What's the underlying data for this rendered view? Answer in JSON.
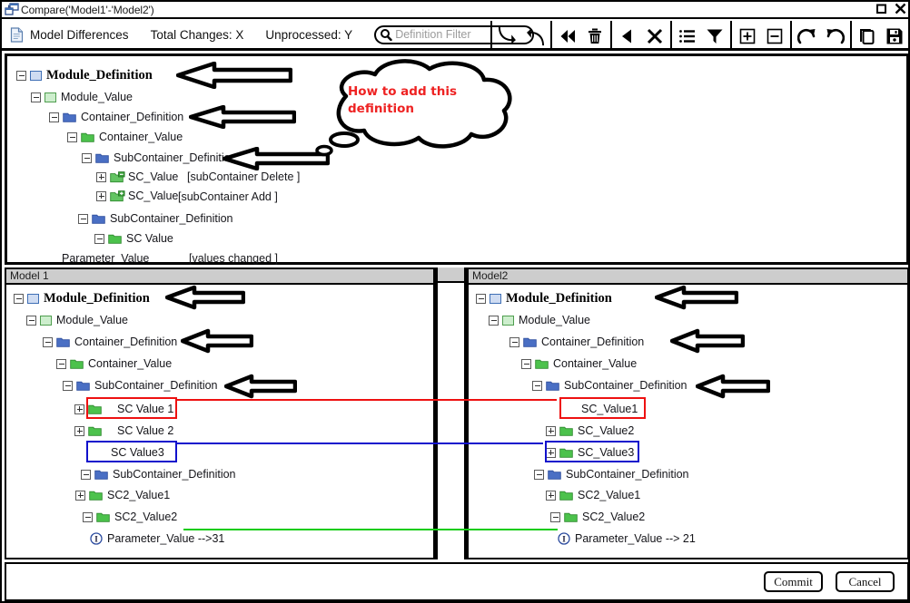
{
  "window": {
    "title": "Compare('Model1'-'Model2')",
    "icon": "compare-window-icon",
    "maximize_label": "maximize-icon",
    "close_label": "close-icon"
  },
  "toolbar": {
    "doc_icon": "document-icon",
    "model_differences_label": "Model Differences",
    "total_changes_label": "Total Changes: X",
    "unprocessed_label": "Unprocessed: Y",
    "search": {
      "icon": "search-icon",
      "placeholder": "Definition Filter",
      "value": ""
    },
    "buttons": [
      {
        "name": "accept-down-icon",
        "group": 1
      },
      {
        "name": "accept-up-icon",
        "group": 1
      },
      {
        "name": "rewind-icon",
        "group": 2
      },
      {
        "name": "delete-trash-icon",
        "group": 2
      },
      {
        "name": "previous-icon",
        "group": 3
      },
      {
        "name": "close-x-icon",
        "group": 3
      },
      {
        "name": "list-icon",
        "group": 4
      },
      {
        "name": "filter-icon",
        "group": 4
      },
      {
        "name": "expand-all-icon",
        "group": 5
      },
      {
        "name": "collapse-all-icon",
        "group": 5
      },
      {
        "name": "redo-icon",
        "group": 6
      },
      {
        "name": "undo-icon",
        "group": 6
      },
      {
        "name": "copy-icon",
        "group": 7
      },
      {
        "name": "save-icon",
        "group": 7
      }
    ]
  },
  "overview_tree": {
    "nodes": [
      {
        "label": "Module_Definition",
        "icon": "square-blue",
        "expander": "minus",
        "bold": true
      },
      {
        "label": "Module_Value",
        "icon": "square-green",
        "expander": "minus",
        "bold": false
      },
      {
        "label": "Container_Definition",
        "icon": "folder-blue",
        "expander": "minus",
        "bold": false
      },
      {
        "label": "Container_Value",
        "icon": "folder-green",
        "expander": "minus",
        "bold": false
      },
      {
        "label": "SubContainer_Definition",
        "icon": "folder-blue",
        "expander": "minus",
        "bold": false
      },
      {
        "label": "SC_Value",
        "icon": "folder-green-delete",
        "expander": "plus",
        "bold": false
      },
      {
        "label": "SC_Value",
        "icon": "folder-green-add",
        "expander": "plus",
        "bold": false
      },
      {
        "label": "SubContainer_Definition",
        "icon": "folder-blue",
        "expander": "minus",
        "bold": false
      },
      {
        "label": "SC Value",
        "icon": "folder-green",
        "expander": "minus",
        "bold": false
      },
      {
        "label": "Parameter_Value",
        "icon": "none",
        "expander": "none",
        "bold": false
      }
    ],
    "notes": [
      {
        "text": "[subContainer Delete ]"
      },
      {
        "text": "[subContainer Add ]"
      },
      {
        "text": "[values changed ]"
      }
    ],
    "callout": {
      "text": "How to add this\ndefinition",
      "color": "#ee2222"
    }
  },
  "panes": {
    "left": {
      "header": "Model 1",
      "nodes": [
        {
          "label": "Module_Definition",
          "icon": "square-blue",
          "expander": "minus",
          "bold": true
        },
        {
          "label": "Module_Value",
          "icon": "square-green",
          "expander": "minus",
          "bold": false
        },
        {
          "label": "Container_Definition",
          "icon": "folder-blue",
          "expander": "minus",
          "bold": false
        },
        {
          "label": "Container_Value",
          "icon": "folder-green",
          "expander": "minus",
          "bold": false
        },
        {
          "label": "SubContainer_Definition",
          "icon": "folder-blue",
          "expander": "minus",
          "bold": false
        },
        {
          "label": "SC Value 1",
          "icon": "folder-green",
          "expander": "plus",
          "bold": false
        },
        {
          "label": "SC Value 2",
          "icon": "folder-green",
          "expander": "plus",
          "bold": false
        },
        {
          "label": "SC Value3",
          "icon": "none",
          "expander": "none",
          "bold": false
        },
        {
          "label": "SubContainer_Definition",
          "icon": "folder-blue",
          "expander": "minus",
          "bold": false
        },
        {
          "label": "SC2_Value1",
          "icon": "folder-green",
          "expander": "plus",
          "bold": false
        },
        {
          "label": "SC2_Value2",
          "icon": "folder-green",
          "expander": "minus",
          "bold": false
        },
        {
          "label": "Parameter_Value -->31",
          "icon": "info-circle",
          "expander": "none",
          "bold": false
        }
      ]
    },
    "right": {
      "header": "Model2",
      "nodes": [
        {
          "label": "Module_Definition",
          "icon": "square-blue",
          "expander": "minus",
          "bold": true
        },
        {
          "label": "Module_Value",
          "icon": "square-green",
          "expander": "minus",
          "bold": false
        },
        {
          "label": "Container_Definition",
          "icon": "folder-blue",
          "expander": "minus",
          "bold": false
        },
        {
          "label": "Container_Value",
          "icon": "folder-green",
          "expander": "minus",
          "bold": false
        },
        {
          "label": "SubContainer_Definition",
          "icon": "folder-blue",
          "expander": "minus",
          "bold": false
        },
        {
          "label": "SC_Value1",
          "icon": "none",
          "expander": "none",
          "bold": false
        },
        {
          "label": "SC_Value2",
          "icon": "folder-green",
          "expander": "plus",
          "bold": false
        },
        {
          "label": "SC_Value3",
          "icon": "folder-green",
          "expander": "plus",
          "bold": false
        },
        {
          "label": "SubContainer_Definition",
          "icon": "folder-blue",
          "expander": "minus",
          "bold": false
        },
        {
          "label": "SC2_Value1",
          "icon": "folder-green",
          "expander": "plus",
          "bold": false
        },
        {
          "label": "SC2_Value2",
          "icon": "folder-green",
          "expander": "minus",
          "bold": false
        },
        {
          "label": "Parameter_Value  --> 21",
          "icon": "info-circle",
          "expander": "none",
          "bold": false
        }
      ]
    }
  },
  "highlights": {
    "red_color": "#ee1111",
    "blue_color": "#1111cc",
    "green_color": "#11cc11"
  },
  "footer": {
    "commit_label": "Commit",
    "cancel_label": "Cancel"
  }
}
